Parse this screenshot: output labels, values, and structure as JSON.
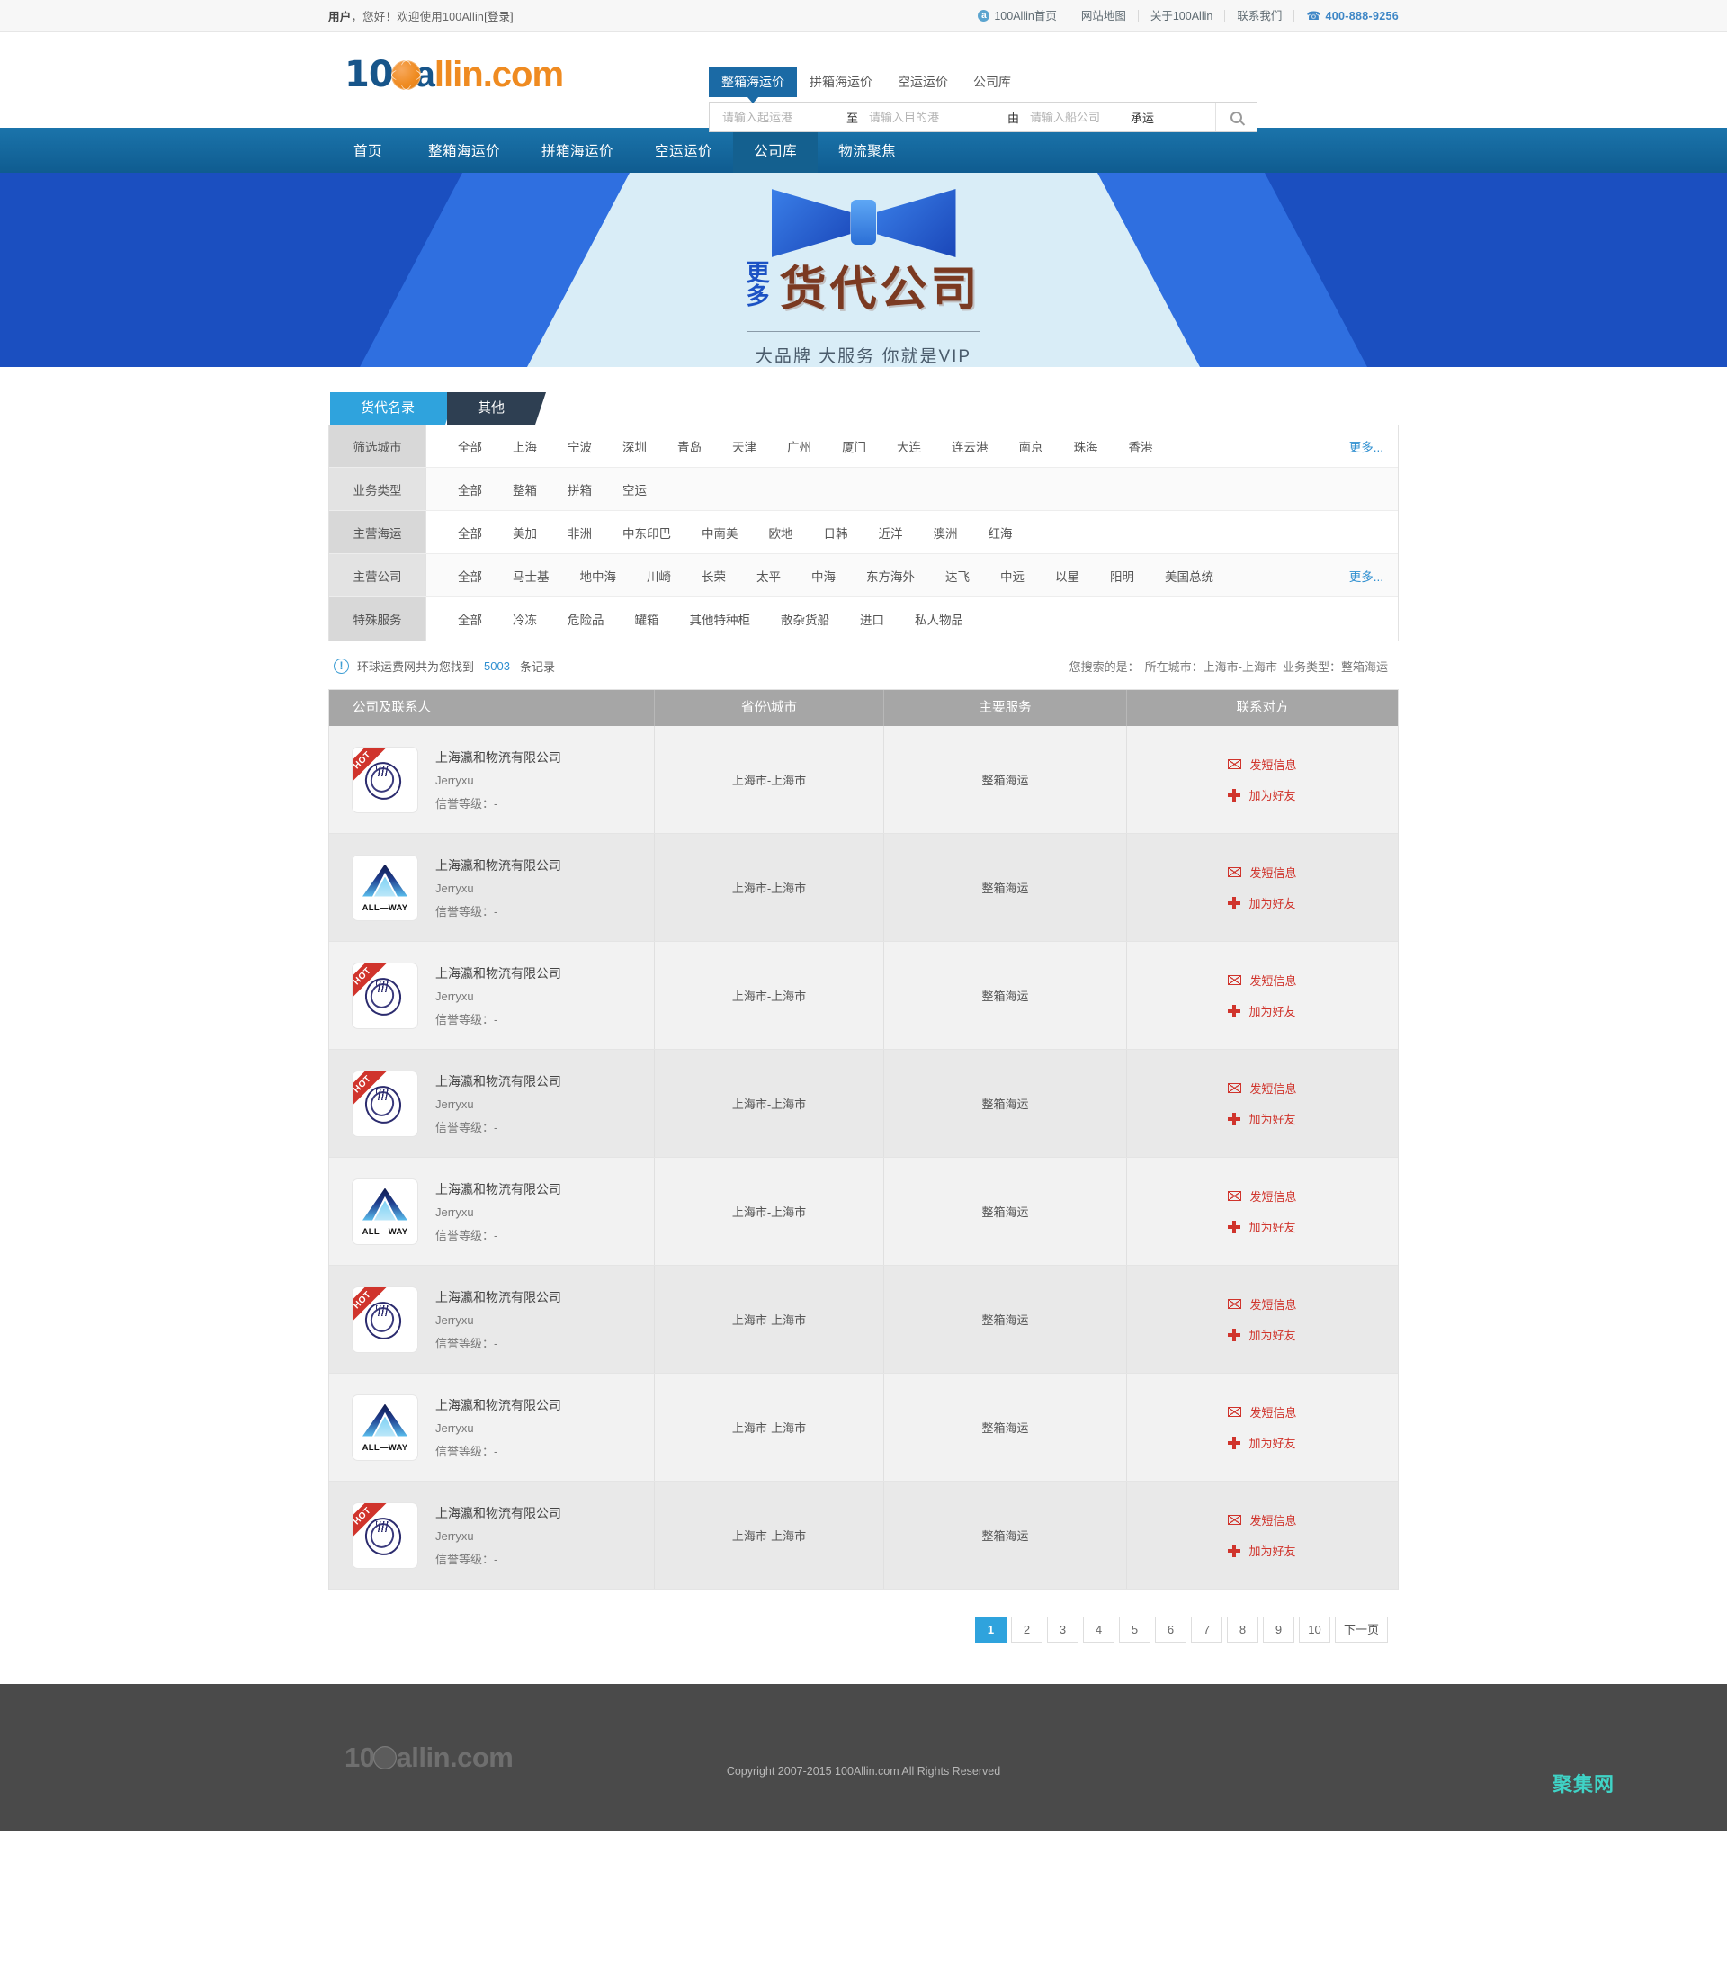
{
  "topbar": {
    "greeting_user": "用户",
    "greeting_rest": "，您好！欢迎使用100Allin",
    "login_label": "[登录]",
    "links": [
      {
        "label": "100Allin首页",
        "icon": "a-badge-icon"
      },
      {
        "label": "网站地图"
      },
      {
        "label": "关于100Allin"
      },
      {
        "label": "联系我们"
      }
    ],
    "phone": "400-888-9256"
  },
  "logo": {
    "part1": "10",
    "part2": "a",
    "part3": "llin.com"
  },
  "search": {
    "tabs": [
      {
        "label": "整箱海运价",
        "active": true
      },
      {
        "label": "拼箱海运价",
        "active": false
      },
      {
        "label": "空运运价",
        "active": false
      },
      {
        "label": "公司库",
        "active": false
      }
    ],
    "origin_placeholder": "请输入起运港",
    "origin_value": "",
    "to_word": "至",
    "dest_placeholder": "请输入目的港",
    "dest_value": "",
    "by_word": "由",
    "carrier_placeholder": "请输入船公司",
    "carrier_value": "",
    "carry_word": "承运",
    "search_icon": "search-icon"
  },
  "mainnav": [
    {
      "label": "首页",
      "active": false
    },
    {
      "label": "整箱海运价",
      "active": false
    },
    {
      "label": "拼箱海运价",
      "active": false
    },
    {
      "label": "空运运价",
      "active": false
    },
    {
      "label": "公司库",
      "active": true
    },
    {
      "label": "物流聚焦",
      "active": false
    }
  ],
  "banner": {
    "more_line1": "更",
    "more_line2": "多",
    "title": "货代公司",
    "subtitle": "大品牌 大服务 你就是VIP"
  },
  "category_tabs": [
    {
      "label": "货代名录",
      "active": true
    },
    {
      "label": "其他",
      "active": false
    }
  ],
  "filters": [
    {
      "label": "筛选城市",
      "options": [
        "全部",
        "上海",
        "宁波",
        "深圳",
        "青岛",
        "天津",
        "广州",
        "厦门",
        "大连",
        "连云港",
        "南京",
        "珠海",
        "香港"
      ],
      "more": "更多..."
    },
    {
      "label": "业务类型",
      "options": [
        "全部",
        "整箱",
        "拼箱",
        "空运"
      ],
      "more": ""
    },
    {
      "label": "主营海运",
      "options": [
        "全部",
        "美加",
        "非洲",
        "中东印巴",
        "中南美",
        "欧地",
        "日韩",
        "近洋",
        "澳洲",
        "红海"
      ],
      "more": ""
    },
    {
      "label": "主营公司",
      "options": [
        "全部",
        "马士基",
        "地中海",
        "川崎",
        "长荣",
        "太平",
        "中海",
        "东方海外",
        "达飞",
        "中远",
        "以星",
        "阳明",
        "美国总统"
      ],
      "more": "更多..."
    },
    {
      "label": "特殊服务",
      "options": [
        "全部",
        "冷冻",
        "危险品",
        "罐箱",
        "其他特种柜",
        "散杂货船",
        "进口",
        "私人物品"
      ],
      "more": ""
    }
  ],
  "result_bar": {
    "prefix": "环球运费网共为您找到",
    "count": "5003",
    "suffix": "条记录",
    "searched_label": "您搜索的是：",
    "criteria_city": "所在城市：上海市-上海市",
    "criteria_type": "业务类型：整箱海运"
  },
  "table": {
    "headers": [
      "公司及联系人",
      "省份\\城市",
      "主要服务",
      "联系对方"
    ],
    "rows": [
      {
        "logo": "swirl",
        "hot": true,
        "name": "上海瀛和物流有限公司",
        "person": "Jerryxu",
        "credit": "信誉等级：-",
        "city": "上海市-上海市",
        "service": "整箱海运",
        "action1": "发短信息",
        "action2": "加为好友"
      },
      {
        "logo": "allway",
        "hot": false,
        "name": "上海瀛和物流有限公司",
        "person": "Jerryxu",
        "credit": "信誉等级：-",
        "city": "上海市-上海市",
        "service": "整箱海运",
        "action1": "发短信息",
        "action2": "加为好友"
      },
      {
        "logo": "swirl",
        "hot": true,
        "name": "上海瀛和物流有限公司",
        "person": "Jerryxu",
        "credit": "信誉等级：-",
        "city": "上海市-上海市",
        "service": "整箱海运",
        "action1": "发短信息",
        "action2": "加为好友"
      },
      {
        "logo": "swirl",
        "hot": true,
        "name": "上海瀛和物流有限公司",
        "person": "Jerryxu",
        "credit": "信誉等级：-",
        "city": "上海市-上海市",
        "service": "整箱海运",
        "action1": "发短信息",
        "action2": "加为好友"
      },
      {
        "logo": "allway",
        "hot": false,
        "name": "上海瀛和物流有限公司",
        "person": "Jerryxu",
        "credit": "信誉等级：-",
        "city": "上海市-上海市",
        "service": "整箱海运",
        "action1": "发短信息",
        "action2": "加为好友"
      },
      {
        "logo": "swirl",
        "hot": true,
        "name": "上海瀛和物流有限公司",
        "person": "Jerryxu",
        "credit": "信誉等级：-",
        "city": "上海市-上海市",
        "service": "整箱海运",
        "action1": "发短信息",
        "action2": "加为好友"
      },
      {
        "logo": "allway",
        "hot": false,
        "name": "上海瀛和物流有限公司",
        "person": "Jerryxu",
        "credit": "信誉等级：-",
        "city": "上海市-上海市",
        "service": "整箱海运",
        "action1": "发短信息",
        "action2": "加为好友"
      },
      {
        "logo": "swirl",
        "hot": true,
        "name": "上海瀛和物流有限公司",
        "person": "Jerryxu",
        "credit": "信誉等级：-",
        "city": "上海市-上海市",
        "service": "整箱海运",
        "action1": "发短信息",
        "action2": "加为好友"
      }
    ]
  },
  "pagination": {
    "pages": [
      "1",
      "2",
      "3",
      "4",
      "5",
      "6",
      "7",
      "8",
      "9",
      "10"
    ],
    "current": "1",
    "next_label": "下一页"
  },
  "footer": {
    "logo_part1": "10",
    "logo_part2": "a",
    "logo_part3": "llin.com",
    "copyright": "Copyright 2007-2015 100Allin.com All Rights Reserved",
    "watermark": "聚集网"
  },
  "colors": {
    "brand_blue": "#1b6aa5",
    "nav_blue": "#14608f",
    "accent_cyan": "#2fa3dd",
    "accent_orange": "#ef8b21",
    "action_red": "#d0342c",
    "banner_blue": "#1c52c4"
  }
}
